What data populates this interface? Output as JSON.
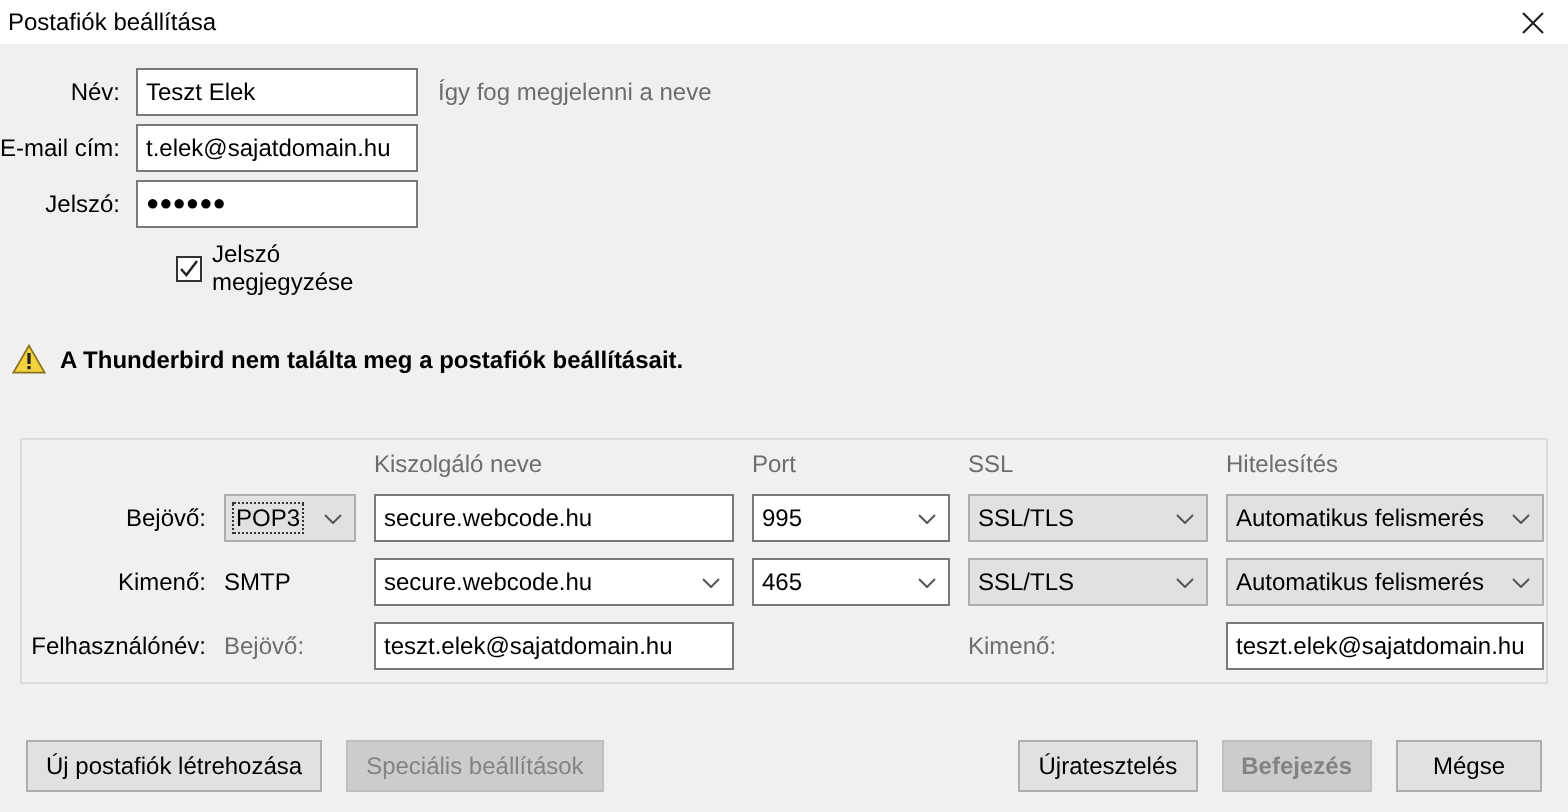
{
  "window": {
    "title": "Postafiók beállítása"
  },
  "account": {
    "fields": [
      {
        "label": "Név:",
        "value": "Teszt Elek",
        "kind": "text",
        "hint": "Így fog megjelenni a neve"
      },
      {
        "label": "E-mail cím:",
        "value": "t.elek@sajatdomain.hu",
        "kind": "text"
      },
      {
        "label": "Jelszó:",
        "value": "●●●●●●",
        "kind": "password"
      }
    ],
    "remember_password": {
      "label": "Jelszó megjegyzése",
      "checked": true
    }
  },
  "warning": {
    "text": "A Thunderbird nem találta meg a postafiók beállításait."
  },
  "server_settings": {
    "headers": [
      "Kiszolgáló neve",
      "Port",
      "SSL",
      "Hitelesítés"
    ],
    "rows": [
      {
        "label": "Bejövő:",
        "protocol": {
          "text": "POP3",
          "kind": "select"
        },
        "server": {
          "value": "secure.webcode.hu",
          "kind": "input"
        },
        "port": "995",
        "ssl": "SSL/TLS",
        "auth": "Automatikus felismerés"
      },
      {
        "label": "Kimenő:",
        "protocol": {
          "text": "SMTP",
          "kind": "label"
        },
        "server": {
          "value": "secure.webcode.hu",
          "kind": "combo"
        },
        "port": "465",
        "ssl": "SSL/TLS",
        "auth": "Automatikus felismerés"
      }
    ],
    "username": {
      "label": "Felhasználónév:",
      "incoming_label": "Bejövő:",
      "incoming_value": "teszt.elek@sajatdomain.hu",
      "outgoing_label": "Kimenő:",
      "outgoing_value": "teszt.elek@sajatdomain.hu"
    }
  },
  "buttons_left": [
    {
      "label": "Új postafiók létrehozása",
      "disabled": false
    },
    {
      "label": "Speciális beállítások",
      "disabled": true
    }
  ],
  "buttons_right": [
    {
      "label": "Újratesztelés",
      "disabled": false
    },
    {
      "label": "Befejezés",
      "disabled": true
    },
    {
      "label": "Mégse",
      "disabled": false
    }
  ]
}
